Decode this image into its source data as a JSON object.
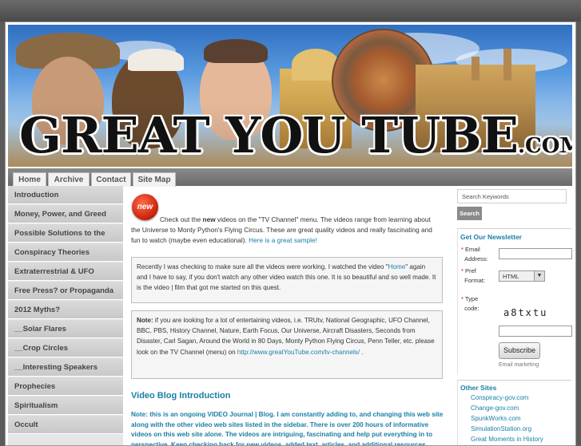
{
  "header": {
    "title_main": "GREAT YOU TUBE",
    "title_suffix": ".COM"
  },
  "nav": {
    "tabs": [
      "Home",
      "Archive",
      "Contact",
      "Site Map"
    ]
  },
  "sidebar_left": {
    "items": [
      "Introduction",
      "Money, Power, and Greed",
      "Possible Solutions to the Crisis",
      "Conspiracy Theories",
      "Extraterrestrial & UFO",
      "Free Press? or Propaganda",
      "2012 Myths?",
      "__Solar Flares",
      "__Crop Circles",
      "__Interesting Speakers",
      "Prophecies",
      "Spiritualism",
      "Occult"
    ]
  },
  "main": {
    "new_badge": "new",
    "intro": {
      "pre": "Check out the ",
      "bold": "new",
      "post": " videos on the \"TV Channel\" menu.  The videos range from learning about the Universe to Monty Python's Flying Circus.   These are great quality videos and really fascinating and fun to watch (maybe even educational).   ",
      "link": "Here is a great sample!"
    },
    "box1": {
      "pre": "Recently I was checking to make sure all the videos were working. I watched the video \"",
      "link": "Home",
      "post": "\" again and I have to say, if you don't watch any other video watch this one. It is so beautiful and so well made. It is the video | film that got me started on this quest."
    },
    "box2": {
      "bold": "Note:",
      "text": " if you are looking for a lot of entertaining videos, i.e. TRUtv, National Geographic, UFO Channel, BBC, PBS, History Channel, Nature, Earth Focus, Our Universe, Aircraft Disasters, Seconds from Disaster, Carl Sagan, Around the World in 80 Days, Monty Python Flying Circus, Penn Teller, etc.  please look on the TV Channel (menu) on ",
      "link": "http://www.greatYouTube.com/tv-channels/",
      "end": " ."
    },
    "section_title": "Video Blog Introduction",
    "section_note": "Note: this is an ongoing VIDEO Journal | Blog.  I am constantly adding to, and changing this web site along with the other video web sites listed in the sidebar.  There is over 200 hours of  informative videos on this web site alone.  The videos are intriguing, fascinating and help put everything in to perspective.   Keep checking back for new videos, added text, articles, and additional resources."
  },
  "sidebar_right": {
    "search_placeholder": "Search Keywords",
    "search_button": "Search",
    "newsletter": {
      "title": "Get Our Newsletter",
      "email_label_1": "Email",
      "email_label_2": "Address:",
      "pref_label_1": "Pref",
      "pref_label_2": "Format:",
      "format_value": "HTML",
      "type_label_1": "Type",
      "type_label_2": "code:",
      "captcha": "a8txtu",
      "subscribe": "Subscribe",
      "footer": "Email marketing"
    },
    "other_sites": {
      "title": "Other Sites",
      "links": [
        "Conspiracy-gov.com",
        "Change-gov.com",
        "SpunkWorks.com",
        "SimulationStation.org",
        "Great Moments in History"
      ]
    }
  },
  "colors": {
    "accent": "#1a7fa6",
    "sidebar_bg": "#dadada",
    "page_bg": "#5b5b5b"
  }
}
